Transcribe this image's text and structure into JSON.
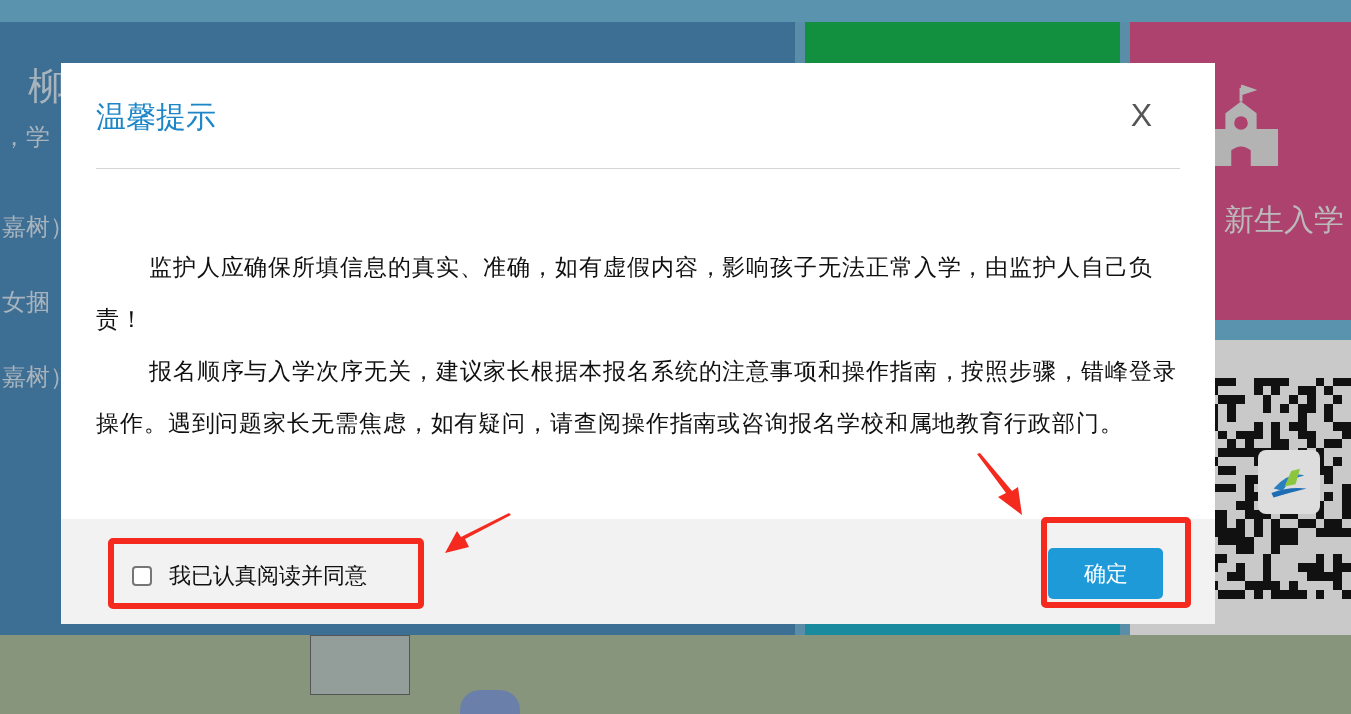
{
  "background": {
    "left_panel_texts": [
      "柳",
      "，学",
      "嘉树）",
      "女捆",
      "嘉树）"
    ],
    "school_tile": {
      "label": "新生入学"
    }
  },
  "dialog": {
    "title": "温馨提示",
    "close": "X",
    "paragraphs": [
      "监护人应确保所填信息的真实、准确，如有虚假内容，影响孩子无法正常入学，由监护人自己负责！",
      "报名顺序与入学次序无关，建议家长根据本报名系统的注意事项和操作指南，按照步骤，错峰登录操作。遇到问题家长无需焦虑，如有疑问，请查阅操作指南或咨询报名学校和属地教育行政部门。"
    ],
    "agree": {
      "label": "我已认真阅读并同意",
      "checked": false
    },
    "confirm": "确定"
  }
}
